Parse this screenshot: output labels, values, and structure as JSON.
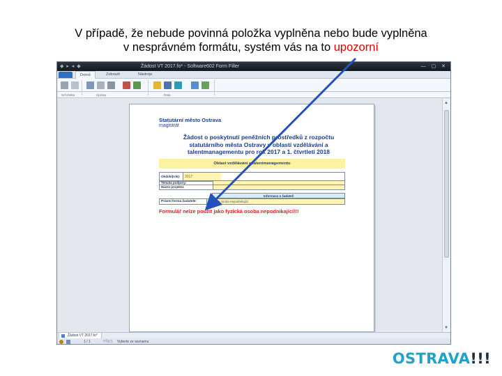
{
  "slide": {
    "caption_line1": "V případě, že nebude povinná položka vyplněna nebo bude vyplněna",
    "caption_line2_prefix": "v nesprávném formátu, systém vás na to ",
    "caption_line2_highlight": "upozorní",
    "highlight_color": "#e00000",
    "logo_text": "OSTRAVA",
    "logo_suffix": "!!!",
    "logo_color": "#1fa3c9"
  },
  "window": {
    "title": "Žádost VT 2017.fo* - Software602 Form Filler",
    "quick_access": "◆ ▸ ◂ ◆",
    "controls": "— ▢ ✕",
    "tabs": [
      "Domů",
      "Zobrazit",
      "Nástroje"
    ],
    "active_tab": "Domů",
    "ribbon_groups": [
      "Schránka",
      "Úpravy",
      "Data"
    ]
  },
  "document": {
    "org_name": "Statutární město Ostrava",
    "org_sub": "magistrát",
    "heading_lines": [
      "Žádost o poskytnutí peněžních prostředků z rozpočtu",
      "statutárního města Ostravy v oblasti vzdělávání a",
      "talentmanagementu pro rok 2017 a 1. čtvrtletí 2018"
    ],
    "area_band": "Oblast vzdělávání a talentmanagementu",
    "fields": [
      {
        "label": "Období(rok):",
        "value": "2017"
      },
      {
        "label": "Témata podpory:",
        "value": ""
      },
      {
        "label": "Název projektu:",
        "value": ""
      }
    ],
    "info_header": "Informace o žadateli",
    "legal_form_label": "Právní forma žadatele:",
    "legal_form_value": "Fyzická osoba nepodnikající",
    "error_message": "Formulář nelze použít jako fyzická osoba nepodnikající!!!",
    "error_color": "#e21b1b"
  },
  "statusbar": {
    "doc_tab": "Žádost VT 2017.fo*",
    "page": "1 / 1",
    "mode": "PŘES",
    "hint": "Vyberte ze seznamu"
  }
}
